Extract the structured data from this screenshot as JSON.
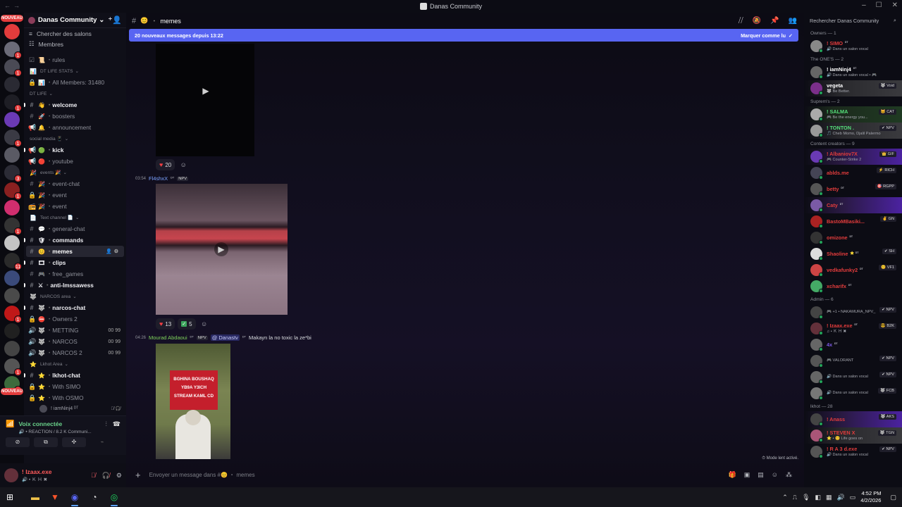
{
  "window": {
    "title": "Danas Community"
  },
  "server_rail": [
    {
      "badge": "",
      "color": "#e23c3c",
      "new": true
    },
    {
      "badge": "1",
      "color": "#6b6b78"
    },
    {
      "badge": "1",
      "color": "#4a4a55"
    },
    {
      "badge": "",
      "color": "#2a2a33"
    },
    {
      "badge": "1",
      "color": "#1e1e25"
    },
    {
      "badge": "",
      "color": "#6b3ab5"
    },
    {
      "badge": "1",
      "color": "#3a3a44"
    },
    {
      "badge": "",
      "color": "#5a5a64"
    },
    {
      "badge": "3",
      "color": "#2b2b35"
    },
    {
      "badge": "1",
      "color": "#8a2020"
    },
    {
      "badge": "",
      "color": "#d02e6e"
    },
    {
      "badge": "1",
      "color": "#333"
    },
    {
      "badge": "",
      "color": "#c4c4c4"
    },
    {
      "badge": "11",
      "color": "#2a2a2a"
    },
    {
      "badge": "",
      "color": "#3a4a7a"
    },
    {
      "badge": "",
      "color": "#4a4a4a"
    },
    {
      "badge": "1",
      "color": "#c01818"
    },
    {
      "badge": "",
      "color": "#202020"
    },
    {
      "badge": "",
      "color": "#444"
    },
    {
      "badge": "1",
      "color": "#555"
    },
    {
      "badge": "9",
      "color": "#3c6b3c"
    },
    {
      "badge": "",
      "color": "#e23c3c",
      "new": true
    }
  ],
  "rail_new_label": "NOUVEAU",
  "server": {
    "name": "Danas Community"
  },
  "sidebar_top": [
    {
      "icon": "≡",
      "label": "Chercher des salons"
    },
    {
      "icon": "☷",
      "label": "Membres"
    }
  ],
  "channels": [
    {
      "kind": "ch",
      "icon": "☑",
      "emoji": "📜",
      "label": "rules",
      "bold": false
    },
    {
      "kind": "cat",
      "emoji": "📊",
      "label": "DT LIFE STATS"
    },
    {
      "kind": "ch",
      "icon": "🔒",
      "emoji": "📊",
      "label": "All Members: 31480",
      "bold": false
    },
    {
      "kind": "cat",
      "emoji": "",
      "label": "DT LIFE"
    },
    {
      "kind": "ch",
      "icon": "#",
      "emoji": "👋",
      "label": "welcome",
      "bold": true,
      "pip": true
    },
    {
      "kind": "ch",
      "icon": "#",
      "emoji": "🚀",
      "label": "boosters",
      "bold": false
    },
    {
      "kind": "ch",
      "icon": "📢",
      "emoji": "🔔",
      "label": "announcement",
      "bold": false
    },
    {
      "kind": "cat",
      "emoji": "",
      "label": "social media 📱"
    },
    {
      "kind": "ch",
      "icon": "📢",
      "emoji": "🟢",
      "label": "kick",
      "bold": true,
      "pip": true
    },
    {
      "kind": "ch",
      "icon": "📢",
      "emoji": "🔴",
      "label": "youtube",
      "bold": false
    },
    {
      "kind": "cat",
      "emoji": "🎉",
      "label": "events 🎉"
    },
    {
      "kind": "ch",
      "icon": "#",
      "emoji": "🎉",
      "label": "event-chat",
      "bold": false
    },
    {
      "kind": "ch",
      "icon": "🔒",
      "emoji": "🎉",
      "label": "event",
      "bold": false
    },
    {
      "kind": "ch",
      "icon": "📻",
      "emoji": "🎉",
      "label": "event",
      "bold": false
    },
    {
      "kind": "cat",
      "emoji": "📄",
      "label": "Text channel 📄"
    },
    {
      "kind": "ch",
      "icon": "#",
      "emoji": "💬",
      "label": "general-chat",
      "bold": false
    },
    {
      "kind": "ch",
      "icon": "#",
      "emoji": "🛡",
      "label": "commands",
      "bold": true,
      "pip": true
    },
    {
      "kind": "ch",
      "icon": "#",
      "emoji": "😊",
      "label": "memes",
      "bold": true,
      "selected": true
    },
    {
      "kind": "ch",
      "icon": "#",
      "emoji": "🎞",
      "label": "clips",
      "bold": true,
      "pip": true
    },
    {
      "kind": "ch",
      "icon": "#",
      "emoji": "🎮",
      "label": "free_games",
      "bold": false
    },
    {
      "kind": "ch",
      "icon": "#",
      "emoji": "⚔",
      "label": "anti-lmssawess",
      "bold": true,
      "pip": true
    },
    {
      "kind": "cat",
      "emoji": "🐺",
      "label": "NARCOS area"
    },
    {
      "kind": "ch",
      "icon": "#",
      "emoji": "🐺",
      "label": "narcos-chat",
      "bold": true,
      "pip": true
    },
    {
      "kind": "ch",
      "icon": "🔒",
      "emoji": "⛔",
      "label": "Owners 2",
      "bold": false
    },
    {
      "kind": "ch",
      "icon": "🔊",
      "emoji": "🐺",
      "label": "METTING",
      "bold": false,
      "right": "00 99"
    },
    {
      "kind": "ch",
      "icon": "🔊",
      "emoji": "🐺",
      "label": "NARCOS",
      "bold": false,
      "right": "00 99"
    },
    {
      "kind": "ch",
      "icon": "🔊",
      "emoji": "🐺",
      "label": "NARCOS 2",
      "bold": false,
      "right": "00 99"
    },
    {
      "kind": "cat",
      "emoji": "⭐",
      "label": "Lkhot Area"
    },
    {
      "kind": "ch",
      "icon": "#",
      "emoji": "⭐",
      "label": "lkhot-chat",
      "bold": true,
      "pip": true
    },
    {
      "kind": "ch",
      "icon": "🔒",
      "emoji": "⭐",
      "label": "With SIMO",
      "bold": false
    },
    {
      "kind": "ch",
      "icon": "🔒",
      "emoji": "⭐",
      "label": "With OSMO",
      "bold": false
    },
    {
      "kind": "vuser",
      "label": "! iamNinj4 ᴰᵀ"
    }
  ],
  "voice": {
    "title": "Voix connectée",
    "subtitle": "🔊 • REACTION / 8.2 K Communi..."
  },
  "user": {
    "name": "! Izaax.exe",
    "status": "🔊 • Ｋ Ｈ ✖"
  },
  "channel": {
    "name": "memes",
    "emoji": "😊"
  },
  "new_messages": {
    "text": "20 nouveaux messages depuis 13:22",
    "mark": "Marquer comme lu"
  },
  "messages": [
    {
      "reactions": [
        {
          "emoji": "❤",
          "count": "20"
        }
      ]
    },
    {
      "time": "03:54",
      "author": "Fl4shxX",
      "tag": "ᴰᵀ",
      "role": "NPV",
      "reactions": [
        {
          "emoji": "❤",
          "count": "13"
        },
        {
          "emoji": "✅",
          "count": "5"
        }
      ]
    },
    {
      "time": "04:26",
      "author": "Mourad Abdaoui",
      "tag": "ᴰᵀ",
      "role": "NPV",
      "mention": "@ Danastv",
      "mention_tag": "ᴰᵀ",
      "content": "Makayn la no toxic la ze*bi",
      "image_text": [
        "BGHINA BOUSHAQ",
        "YB9A Y3ICH",
        "STREAM KAML CD"
      ]
    }
  ],
  "slowmode": "Mode lent activé.",
  "composer": {
    "placeholder": "Envoyer un message dans #😊 ・ memes"
  },
  "members_search": "Rechercher Danas Community",
  "member_groups": [
    {
      "label": "Owners — 1",
      "members": [
        {
          "name": "! SIMO",
          "tag": "ᴰᵀ",
          "status": "🔊 Dans un salon vocal",
          "color": "#e23c3c",
          "av": "#888"
        }
      ]
    },
    {
      "label": "The ONE'S — 2",
      "members": [
        {
          "name": "! iamNinj4",
          "tag": "ᴰᵀ",
          "status": "🔊 Dans un salon vocal • 🎮",
          "color": "#ffffff",
          "av": "#666"
        },
        {
          "name": "vegeta",
          "tag": "",
          "status": "🐺 Be Better.",
          "color": "#ffffff",
          "av": "#7b2f8a",
          "mtag": "🐺 Void",
          "banner": "banner3"
        }
      ]
    },
    {
      "label": "Suprem's — 2",
      "members": [
        {
          "name": "! SALMA",
          "tag": "",
          "status": "🎮 Be the energy you...",
          "color": "#55e07a",
          "av": "#aaa",
          "mtag": "🐱 CAT",
          "banner": "banner"
        },
        {
          "name": "! TONTON .",
          "tag": "",
          "status": "🎵 Cheb Momo, Djalil Palermo",
          "color": "#55e07a",
          "av": "#999",
          "mtag": "✔ NPV",
          "banner": "banner3"
        }
      ]
    },
    {
      "label": "Content creators — 9",
      "members": [
        {
          "name": "! Albaniov7X",
          "tag": "",
          "status": "🎮 Counter-Strike 2",
          "color": "#e23c3c",
          "av": "#6a3ab5",
          "mtag": "👑 GIF",
          "banner": "banner2"
        },
        {
          "name": "ablds.me",
          "tag": "",
          "status": "",
          "color": "#e23c3c",
          "av": "#445",
          "mtag": "⚡ RICH"
        },
        {
          "name": "betty",
          "tag": "ᴰᵀ",
          "status": "",
          "color": "#e23c3c",
          "av": "#555",
          "mtag": "🎯 RGPP"
        },
        {
          "name": "Caty",
          "tag": "ᴰᵀ",
          "status": "",
          "color": "#e23c3c",
          "av": "#7a5aa5",
          "banner": "banner2"
        },
        {
          "name": "BastoMBasiki...",
          "tag": "",
          "status": "",
          "color": "#e23c3c",
          "av": "#a22",
          "mtag": "✌ GN"
        },
        {
          "name": "omizone",
          "tag": "ᴰᵀ",
          "status": "",
          "color": "#e23c3c",
          "av": "#333"
        },
        {
          "name": "Shaoline",
          "tag": "⭐ ᴰᵀ",
          "status": "",
          "color": "#e23c3c",
          "av": "#ddd",
          "mtag": "✔ SH"
        },
        {
          "name": "vedkafunky2",
          "tag": "ᴰᵀ",
          "status": "",
          "color": "#e23c3c",
          "av": "#c44",
          "mtag": "😊 VF1"
        },
        {
          "name": "xcharifx",
          "tag": "ᴰᵀ",
          "status": "",
          "color": "#e23c3c",
          "av": "#4a6"
        }
      ]
    },
    {
      "label": "Admin — 6",
      "members": [
        {
          "name": "",
          "tag": "",
          "status": "🎮 +1 • NAKAMURA_NPV_",
          "color": "#ffffff",
          "av": "#444",
          "mtag": "✔ NPV"
        },
        {
          "name": "! Izaax.exe",
          "tag": "ᴰᵀ",
          "status": "♫ • Ｋ Ｈ ✖",
          "color": "#e23c3c",
          "av": "#63303a",
          "mtag": "😎 B2K"
        },
        {
          "name": "4x",
          "tag": "ᴰᵀ",
          "status": "",
          "color": "#7a58e0",
          "av": "#666"
        },
        {
          "name": "",
          "tag": "",
          "status": "🎮 VALORANT",
          "color": "#ffffff",
          "av": "#555",
          "mtag": "✔ NPV"
        },
        {
          "name": "",
          "tag": "",
          "status": "🔊 Dans un salon vocal",
          "color": "#ffffff",
          "av": "#666",
          "mtag": "✔ NPV"
        },
        {
          "name": "",
          "tag": "",
          "status": "🔊 Dans un salon vocal",
          "color": "#ffffff",
          "av": "#777",
          "mtag": "🐺 FCB"
        }
      ]
    },
    {
      "label": "lkhot — 28",
      "members": [
        {
          "name": "! Anass",
          "tag": "",
          "status": "",
          "color": "#e23c3c",
          "av": "#444",
          "mtag": "🐺 AKS",
          "banner": "banner2"
        },
        {
          "name": "! STEVEN X",
          "tag": "",
          "status": "⭐ • 😊 Life goes on",
          "color": "#e23c3c",
          "av": "#a57",
          "mtag": "🐺 TGN",
          "banner": "banner3"
        },
        {
          "name": "! R A 3 d.exe",
          "tag": "",
          "status": "🔊 Dans un salon vocal",
          "color": "#e23c3c",
          "av": "#555",
          "mtag": "✔ NPV"
        }
      ]
    }
  ],
  "taskbar": {
    "time": "4:52 PM",
    "date": "4/2/2026"
  }
}
